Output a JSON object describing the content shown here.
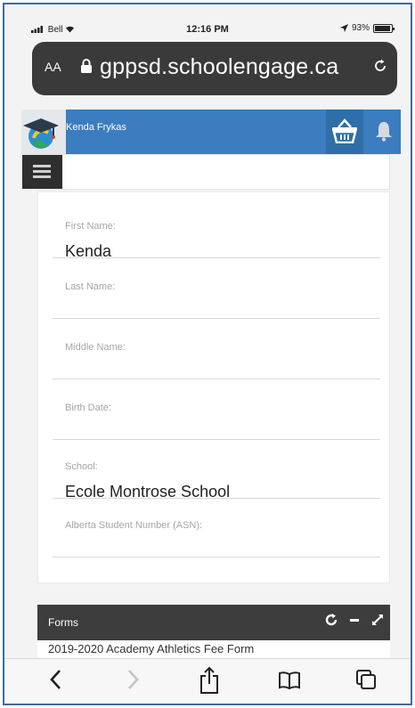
{
  "status_bar": {
    "carrier": "Bell",
    "time": "12:16 PM",
    "battery_label": "93%",
    "battery_level": 0.93
  },
  "browser": {
    "text_size_label": "AA",
    "url": "gppsd.schoolengage.ca",
    "icons": [
      "lock-icon",
      "reload-icon"
    ]
  },
  "app_header": {
    "user_name": "Kenda Frykas",
    "brand_color": "#3b7dbf",
    "icons": [
      "graduation-cap-logo",
      "basket-icon",
      "bell-icon"
    ]
  },
  "menu": {
    "icon": "hamburger-icon"
  },
  "student_form": {
    "fields": [
      {
        "label": "First Name:",
        "value": "Kenda"
      },
      {
        "label": "Last Name:",
        "value": ""
      },
      {
        "label": "Middle Name:",
        "value": ""
      },
      {
        "label": "Birth Date:",
        "value": ""
      },
      {
        "label": "School:",
        "value": "Ecole Montrose School"
      },
      {
        "label": "Alberta Student Number (ASN):",
        "value": ""
      }
    ]
  },
  "forms_panel": {
    "title": "Forms",
    "tool_icons": [
      "refresh-icon",
      "minimize-icon",
      "expand-icon"
    ],
    "first_item": "2019-2020 Academy Athletics Fee Form"
  },
  "toolbar": {
    "icons": [
      "back-icon",
      "forward-icon",
      "share-icon",
      "bookmarks-icon",
      "tabs-icon"
    ]
  }
}
